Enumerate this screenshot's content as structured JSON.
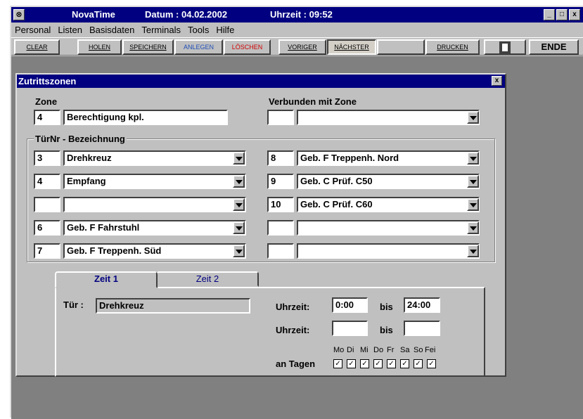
{
  "window": {
    "app_name": "NovaTime",
    "date_label": "Datum : 04.02.2002",
    "time_label": "Uhrzeit : 09:52",
    "controls": [
      "_",
      "□",
      "x"
    ]
  },
  "menu": [
    "Personal",
    "Listen",
    "Basisdaten",
    "Terminals",
    "Tools",
    "Hilfe"
  ],
  "toolbar": {
    "clear": "CLEAR",
    "holen": "HOLEN",
    "speichern": "SPEICHERN",
    "anlegen": "ANLEGEN",
    "loeschen": "LÖSCHEN",
    "voriger": "VORIGER",
    "naechster": "NÄCHSTER",
    "drucken": "DRUCKEN",
    "exit_icon": "door-exit-icon",
    "ende": "ENDE",
    "colors": {
      "anlegen": "#1f4fb8",
      "loeschen": "#d00000"
    }
  },
  "dialog": {
    "title": "Zutrittszonen",
    "close": "x",
    "zone_label": "Zone",
    "zone_nr": "4",
    "zone_name": "Berechtigung kpl.",
    "linked_label": "Verbunden mit Zone",
    "linked_nr": "",
    "linked_name": "",
    "doors_label": "TürNr - Bezeichnung",
    "doors_left": [
      {
        "nr": "3",
        "name": "Drehkreuz"
      },
      {
        "nr": "4",
        "name": "Empfang"
      },
      {
        "nr": "",
        "name": ""
      },
      {
        "nr": "6",
        "name": "Geb. F Fahrstuhl"
      },
      {
        "nr": "7",
        "name": "Geb. F Treppenh. Süd"
      }
    ],
    "doors_right": [
      {
        "nr": "8",
        "name": "Geb. F Treppenh. Nord"
      },
      {
        "nr": "9",
        "name": "Geb. C Prüf. C50"
      },
      {
        "nr": "10",
        "name": "Geb. C Prüf. C60"
      },
      {
        "nr": "",
        "name": ""
      },
      {
        "nr": "",
        "name": ""
      }
    ],
    "tabs": [
      "Zeit 1",
      "Zeit 2"
    ],
    "door_label": "Tür :",
    "door_value": "Drehkreuz",
    "time_label": "Uhrzeit:",
    "time1_from": "0:00",
    "time1_to": "24:00",
    "bis_label": "bis",
    "time2_from": "",
    "time2_to": "",
    "days_label": "an Tagen",
    "days": [
      "Mo",
      "Di",
      "Mi",
      "Do",
      "Fr",
      "Sa",
      "So",
      "Fei"
    ],
    "days_checked": [
      true,
      true,
      true,
      true,
      true,
      true,
      true,
      true
    ]
  }
}
